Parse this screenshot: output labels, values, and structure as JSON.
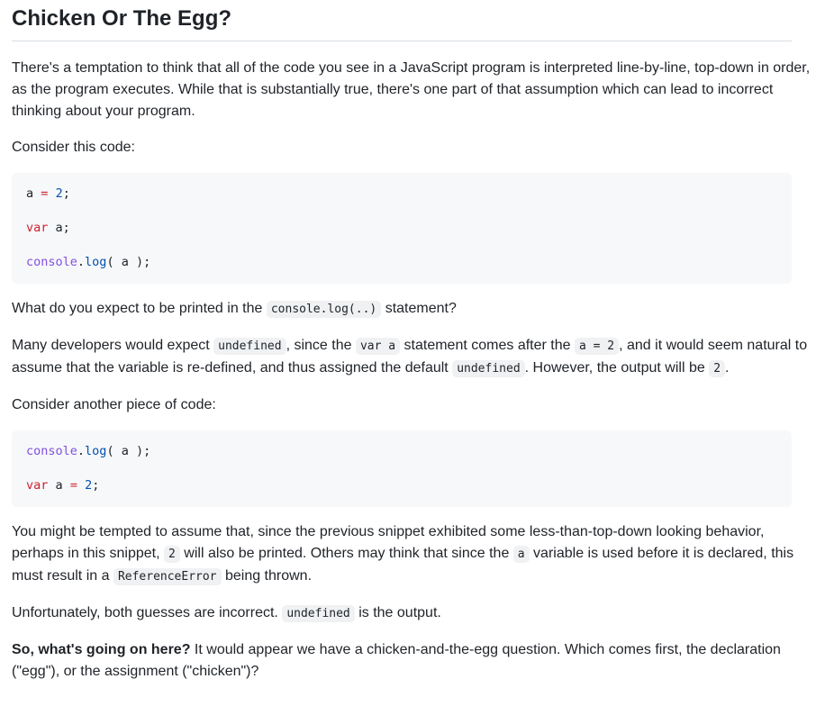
{
  "heading": "Chicken Or The Egg?",
  "para1": "There's a temptation to think that all of the code you see in a JavaScript program is interpreted line-by-line, top-down in order, as the program executes. While that is substantially true, there's one part of that assumption which can lead to incorrect thinking about your program.",
  "para2": "Consider this code:",
  "code1": {
    "line1": {
      "id": "a",
      "op": "=",
      "num": "2",
      "end": ";"
    },
    "line2": {
      "kw": "var",
      "rest": "a;"
    },
    "line3": {
      "obj": "console",
      "dot": ".",
      "fn": "log",
      "rest": "( a );"
    }
  },
  "para3": {
    "before": "What do you expect to be printed in the ",
    "code": "console.log(..)",
    "after": " statement?"
  },
  "para4": {
    "t1": "Many developers would expect ",
    "c1": "undefined",
    "t2": ", since the ",
    "c2": "var a",
    "t3": " statement comes after the ",
    "c3": "a = 2",
    "t4": ", and it would seem natural to assume that the variable is re-defined, and thus assigned the default ",
    "c4": "undefined",
    "t5": ". However, the output will be ",
    "c5": "2",
    "t6": "."
  },
  "para5": "Consider another piece of code:",
  "code2": {
    "line1": {
      "obj": "console",
      "dot": ".",
      "fn": "log",
      "rest": "( a );"
    },
    "line2": {
      "kw": "var",
      "id": "a",
      "op": "=",
      "num": "2",
      "end": ";"
    }
  },
  "para6": {
    "t1": "You might be tempted to assume that, since the previous snippet exhibited some less-than-top-down looking behavior, perhaps in this snippet, ",
    "c1": "2",
    "t2": " will also be printed. Others may think that since the ",
    "c2": "a",
    "t3": " variable is used before it is declared, this must result in a ",
    "c3": "ReferenceError",
    "t4": " being thrown."
  },
  "para7": {
    "t1": "Unfortunately, both guesses are incorrect. ",
    "c1": "undefined",
    "t2": " is the output."
  },
  "para8": {
    "bold": "So, what's going on here?",
    "rest": " It would appear we have a chicken-and-the-egg question. Which comes first, the declaration (\"egg\"), or the assignment (\"chicken\")?"
  }
}
